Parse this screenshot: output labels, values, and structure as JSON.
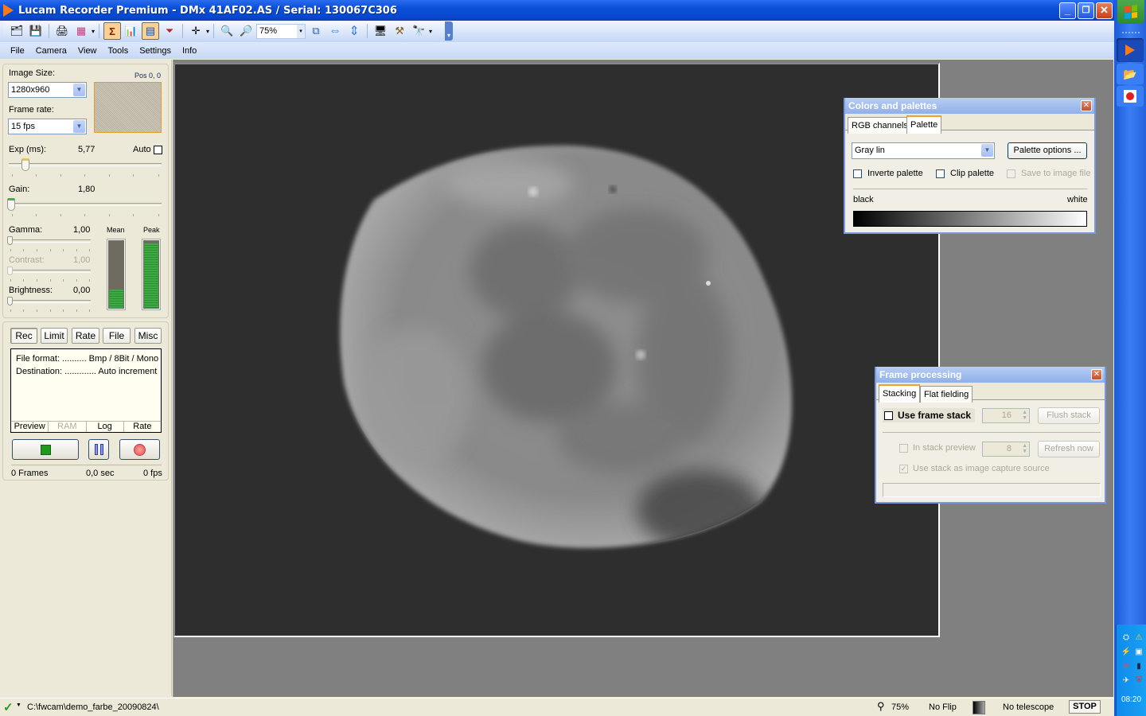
{
  "window": {
    "title": "Lucam Recorder Premium - DMx 41AF02.AS / Serial: 130067C306",
    "buttons": {
      "minimize": "_",
      "restore": "❐",
      "close": "✕"
    }
  },
  "toolbar": {
    "items": [
      {
        "name": "open-folders-icon",
        "glyph": "🗂"
      },
      {
        "name": "save-icon",
        "glyph": "💾"
      },
      {
        "name": "print-icon",
        "glyph": "🖨"
      },
      {
        "name": "color-grid-icon",
        "glyph": "▦"
      },
      {
        "name": "sigma-icon",
        "glyph": "Σ"
      },
      {
        "name": "histogram-icon",
        "glyph": "📊"
      },
      {
        "name": "calculator-icon",
        "glyph": "▤"
      },
      {
        "name": "filter-icon",
        "glyph": "⏷"
      },
      {
        "name": "crosshair-icon",
        "glyph": "✛"
      },
      {
        "name": "zoom-in-icon",
        "glyph": "🔍"
      },
      {
        "name": "zoom-out-icon",
        "glyph": "🔎"
      },
      {
        "name": "fit-window-icon",
        "glyph": "⧉"
      },
      {
        "name": "flip-horizontal-icon",
        "glyph": "⇔"
      },
      {
        "name": "flip-vertical-icon",
        "glyph": "⇕"
      },
      {
        "name": "monitor-icon",
        "glyph": "🖥"
      },
      {
        "name": "tools-icon",
        "glyph": "⚒"
      },
      {
        "name": "telescope-icon",
        "glyph": "🔭"
      }
    ],
    "zoom_value": "75%",
    "dropdown_glyph": "▾",
    "overflow_glyph": "▾"
  },
  "menu": [
    "File",
    "Camera",
    "View",
    "Tools",
    "Settings",
    "Info"
  ],
  "camera": {
    "image_size_label": "Image Size:",
    "image_size_value": "1280x960",
    "pos_label": "Pos 0, 0",
    "frame_rate_label": "Frame rate:",
    "frame_rate_value": "15 fps",
    "exposure_label": "Exp (ms):",
    "exposure_value": "5,77",
    "exposure_fraction": 0.1,
    "auto_label": "Auto",
    "auto_checked": false,
    "gain_label": "Gain:",
    "gain_value": "1,80",
    "gain_fraction": 0.0,
    "gamma_label": "Gamma:",
    "gamma_value": "1,00",
    "contrast_label": "Contrast:",
    "contrast_value": "1,00",
    "brightness_label": "Brightness:",
    "brightness_value": "0,00",
    "mean_label": "Mean",
    "mean_level": 0.27,
    "peak_label": "Peak",
    "peak_level": 0.97
  },
  "record": {
    "tabs": [
      "Rec",
      "Limit",
      "Rate",
      "File",
      "Misc"
    ],
    "active_tab": "Rec",
    "file_format_line": "File format: .......... Bmp / 8Bit / Mono",
    "destination_line": "Destination: ............. Auto increment",
    "sub_tabs": [
      "Preview",
      "RAM",
      "Log",
      "Rate"
    ],
    "frames": "0 Frames",
    "seconds": "0,0 sec",
    "fps": "0 fps",
    "colors": {
      "stop": "#1f9a1f",
      "pause": "#6a7bf0",
      "record": "#f07070"
    }
  },
  "colors_window": {
    "title": "Colors and palettes",
    "tabs": [
      "RGB channels",
      "Palette"
    ],
    "active_tab": "Palette",
    "palette_value": "Gray lin",
    "palette_options_label": "Palette options ...",
    "invert_label": "Inverte palette",
    "clip_label": "Clip palette",
    "save_label": "Save to image file",
    "black_label": "black",
    "white_label": "white"
  },
  "frame_window": {
    "title": "Frame processing",
    "tabs": [
      "Stacking",
      "Flat fielding"
    ],
    "active_tab": "Stacking",
    "use_stack_label": "Use frame stack",
    "stack_count": "16",
    "flush_label": "Flush stack",
    "in_stack_preview_label": "In stack preview",
    "preview_count": "8",
    "refresh_label": "Refresh now",
    "capture_source_label": "Use stack as image capture source",
    "capture_source_checked": true
  },
  "status": {
    "path": "C:\\fwcam\\demo_farbe_20090824\\",
    "zoom": "75%",
    "flip": "No Flip",
    "telescope": "No telescope",
    "stop_label": "STOP"
  },
  "taskbar": {
    "clock": "08:20"
  }
}
